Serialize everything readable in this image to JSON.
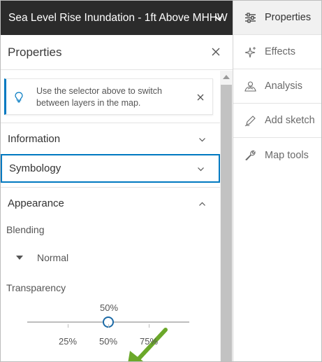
{
  "layer_header": {
    "title": "Sea Level Rise Inundation - 1ft Above MHHW"
  },
  "panel": {
    "title": "Properties",
    "notice": {
      "text": "Use the selector above to switch between layers in the map."
    },
    "sections": {
      "information": "Information",
      "symbology": "Symbology",
      "appearance": "Appearance"
    },
    "blending": {
      "label": "Blending",
      "value": "Normal"
    },
    "transparency": {
      "label": "Transparency",
      "value_label": "50%",
      "value": 0.5,
      "ticks": [
        "25%",
        "50%",
        "75%"
      ]
    }
  },
  "toolbar": {
    "items": [
      {
        "label": "Properties",
        "icon": "sliders-icon",
        "active": true
      },
      {
        "label": "Effects",
        "icon": "sparkle-icon",
        "active": false
      },
      {
        "label": "Analysis",
        "icon": "analysis-icon",
        "active": false
      },
      {
        "label": "Add sketch",
        "icon": "pencil-icon",
        "active": false
      },
      {
        "label": "Map tools",
        "icon": "wrench-icon",
        "active": false
      }
    ]
  },
  "colors": {
    "header_bg": "#2b2b2b",
    "accent": "#0079c1",
    "arrow": "#6ba82a"
  }
}
